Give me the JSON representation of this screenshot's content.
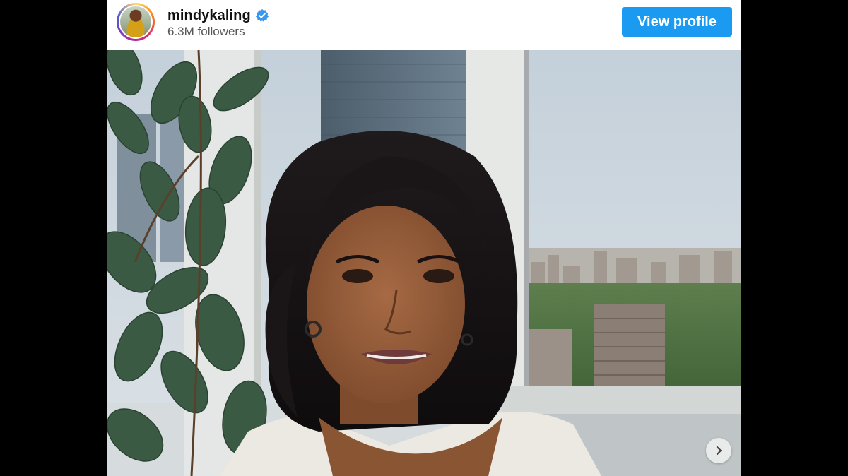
{
  "post": {
    "username": "mindykaling",
    "followers": "6.3M followers",
    "view_profile_label": "View profile"
  },
  "icons": {
    "verified": "verified-badge-icon",
    "next": "chevron-right-icon"
  },
  "colors": {
    "button_blue": "#1a9af0",
    "verified_blue": "#3897f0",
    "background": "#000000"
  }
}
